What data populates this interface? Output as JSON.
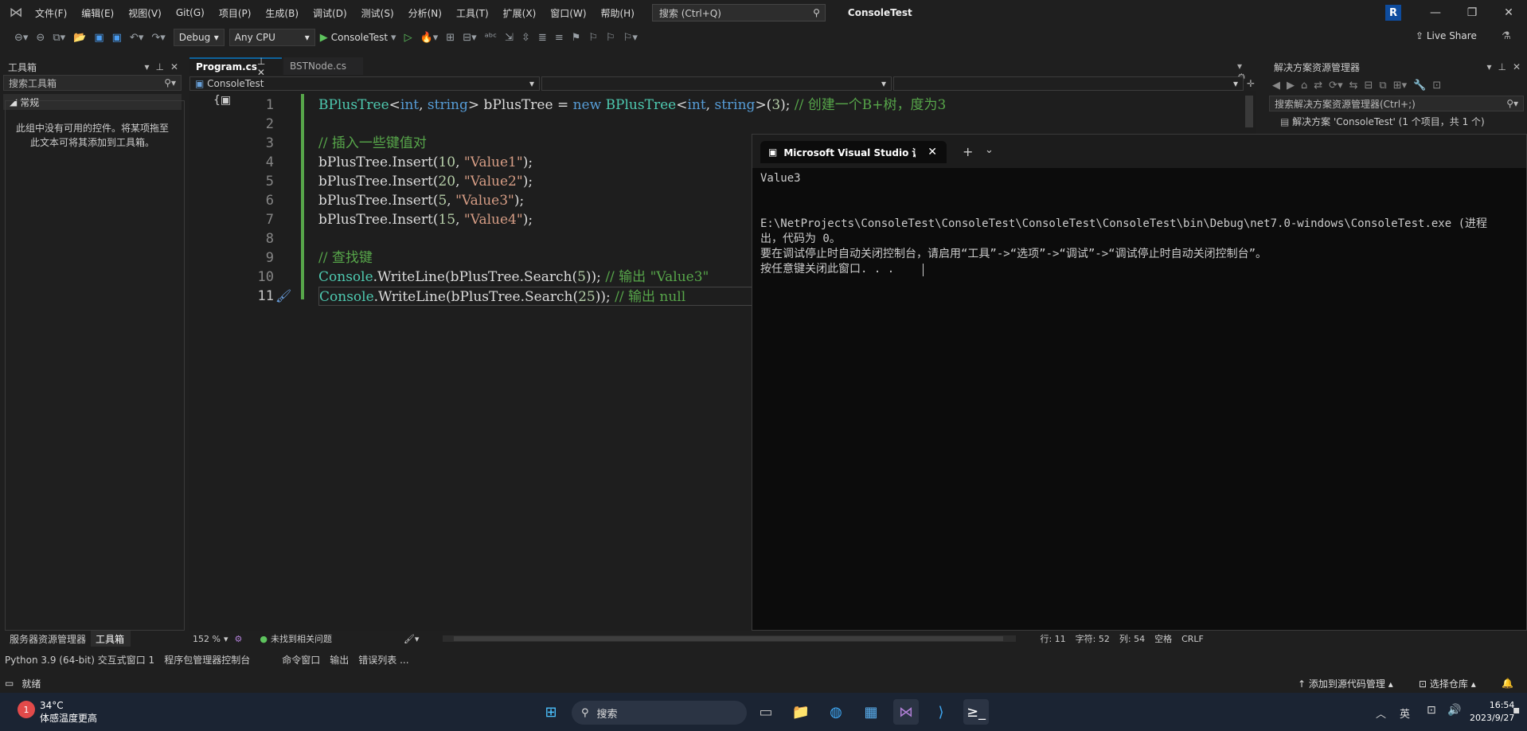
{
  "menubar": {
    "items": [
      "文件(F)",
      "编辑(E)",
      "视图(V)",
      "Git(G)",
      "项目(P)",
      "生成(B)",
      "调试(D)",
      "测试(S)",
      "分析(N)",
      "工具(T)",
      "扩展(X)",
      "窗口(W)",
      "帮助(H)"
    ],
    "search_placeholder": "搜索 (Ctrl+Q)",
    "app_title": "ConsoleTest",
    "avatar_letter": "R"
  },
  "toolbar": {
    "config": "Debug",
    "platform": "Any CPU",
    "run_target": "ConsoleTest",
    "live_share": "Live Share"
  },
  "toolbox": {
    "title": "工具箱",
    "search_placeholder": "搜索工具箱",
    "group": "常规",
    "empty_msg_line1": "此组中没有可用的控件。将某项拖至",
    "empty_msg_line2": "此文本可将其添加到工具箱。",
    "tab_server": "服务器资源管理器",
    "tab_toolbox": "工具箱"
  },
  "editor": {
    "tabs": [
      "Program.cs",
      "BSTNode.cs"
    ],
    "nav_project": "ConsoleTest",
    "line_numbers": [
      "1",
      "2",
      "3",
      "4",
      "5",
      "6",
      "7",
      "8",
      "9",
      "10",
      "11"
    ],
    "zoom": "152 %",
    "issues": "未找到相关问题",
    "line_info": "行: 11",
    "char_info": "字符: 52",
    "col_info": "列: 54",
    "spaces": "空格",
    "eol": "CRLF"
  },
  "code": {
    "l1a": "BPlusTree",
    "l1b": "<",
    "l1c": "int",
    "l1d": ", ",
    "l1e": "string",
    "l1f": "> bPlusTree = ",
    "l1g": "new",
    "l1h": " ",
    "l1i": "BPlusTree",
    "l1j": "<",
    "l1k": "int",
    "l1l": ", ",
    "l1m": "string",
    "l1n": ">(",
    "l1o": "3",
    "l1p": "); ",
    "l1q": "// 创建一个B+树，度为3",
    "l3": "// 插入一些键值对",
    "l4a": "bPlusTree.Insert(",
    "l4b": "10",
    "l4c": ", ",
    "l4d": "\"Value1\"",
    "l4e": ");",
    "l5a": "bPlusTree.Insert(",
    "l5b": "20",
    "l5c": ", ",
    "l5d": "\"Value2\"",
    "l5e": ");",
    "l6a": "bPlusTree.Insert(",
    "l6b": "5",
    "l6c": ", ",
    "l6d": "\"Value3\"",
    "l6e": ");",
    "l7a": "bPlusTree.Insert(",
    "l7b": "15",
    "l7c": ", ",
    "l7d": "\"Value4\"",
    "l7e": ");",
    "l9": "// 查找键",
    "l10a": "Console",
    "l10b": ".WriteLine(bPlusTree.Search(",
    "l10c": "5",
    "l10d": ")); ",
    "l10e": "// 输出 \"Value3\"",
    "l11a": "Console",
    "l11b": ".WriteLine(bPlusTree.Search(",
    "l11c": "25",
    "l11d": ")); ",
    "l11e": "// 输出 null"
  },
  "console": {
    "tab_title": "Microsoft Visual Studio 调试控制台",
    "lines": [
      "Value3",
      "",
      "",
      "E:\\NetProjects\\ConsoleTest\\ConsoleTest\\ConsoleTest\\ConsoleTest\\bin\\Debug\\net7.0-windows\\ConsoleTest.exe (进程",
      "出，代码为 0。",
      "要在调试停止时自动关闭控制台，请启用“工具”->“选项”->“调试”->“调试停止时自动关闭控制台”。",
      "按任意键关闭此窗口. . ."
    ]
  },
  "solution_explorer": {
    "title": "解决方案资源管理器",
    "search_placeholder": "搜索解决方案资源管理器(Ctrl+;)",
    "solution_item": "解决方案 'ConsoleTest' (1 个项目，共 1 个)"
  },
  "bottom_tabs": [
    "Python 3.9 (64-bit) 交互式窗口 1",
    "程序包管理器控制台",
    "命令窗口",
    "输出",
    "错误列表 ..."
  ],
  "status": {
    "ready": "就绪",
    "add_source": "添加到源代码管理",
    "select_repo": "选择仓库"
  },
  "taskbar": {
    "weather_temp": "34°C",
    "weather_desc": "体感温度更高",
    "badge": "1",
    "search": "搜索",
    "ime": "英",
    "time": "16:54",
    "date": "2023/9/27"
  },
  "colors": {
    "accent": "#0e639c",
    "comment": "#57a64a",
    "keyword": "#569cd6",
    "type": "#4ec9b0",
    "string": "#d69d85"
  }
}
